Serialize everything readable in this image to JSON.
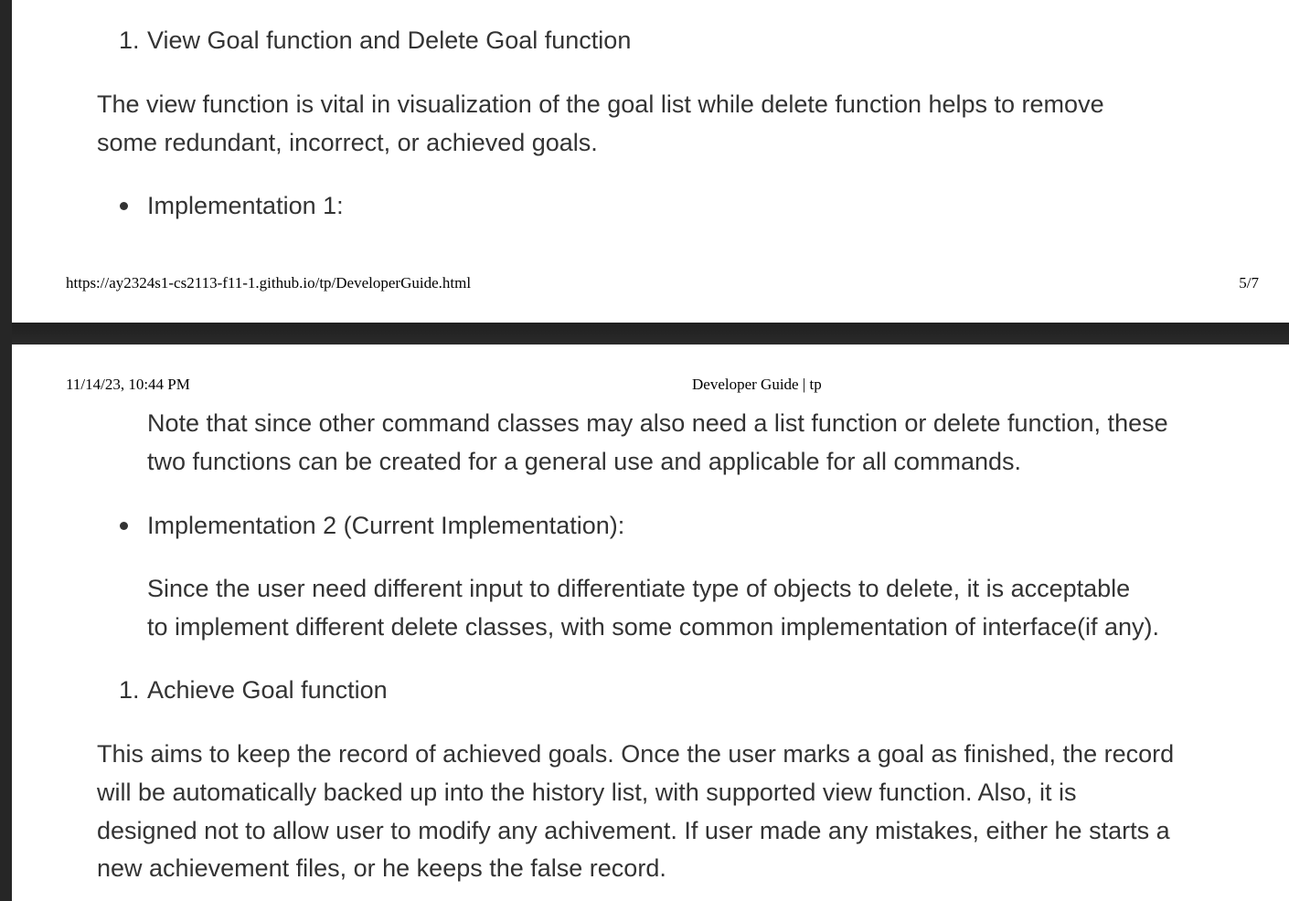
{
  "page_top": {
    "list_item_1": {
      "marker": "1.",
      "text": "View Goal function and Delete Goal function"
    },
    "paragraph_1": {
      "line1": "The view function is vital in visualization of the goal list while delete function helps to remove",
      "line2": "some redundant, incorrect, or achieved goals."
    },
    "bullet_1": {
      "text": "Implementation 1:"
    },
    "footer": {
      "url": "https://ay2324s1-cs2113-f11-1.github.io/tp/DeveloperGuide.html",
      "page_number": "5/7"
    }
  },
  "page_bottom": {
    "header": {
      "datetime": "11/14/23, 10:44 PM",
      "title": "Developer Guide | tp"
    },
    "note_paragraph": {
      "line1": "Note that since other command classes may also need a list function or delete function, these",
      "line2": "two functions can be created for a general use and applicable for all commands."
    },
    "bullet_2": {
      "text": "Implementation 2 (Current Implementation):"
    },
    "impl2_paragraph": {
      "line1": "Since the user need different input to differentiate type of objects to delete, it is acceptable",
      "line2": "to implement different delete classes, with some common implementation of interface(if any)."
    },
    "list_item_2": {
      "marker": "1.",
      "text": "Achieve Goal function"
    },
    "paragraph_2": {
      "line1": "This aims to keep the record of achieved goals. Once the user marks a goal as finished, the record",
      "line2": "will be automatically backed up into the history list, with supported view function. Also, it is",
      "line3": "designed not to allow user to modify any achivement. If user made any mistakes, either he starts a",
      "line4": "new achievement files, or he keeps the false record."
    }
  }
}
